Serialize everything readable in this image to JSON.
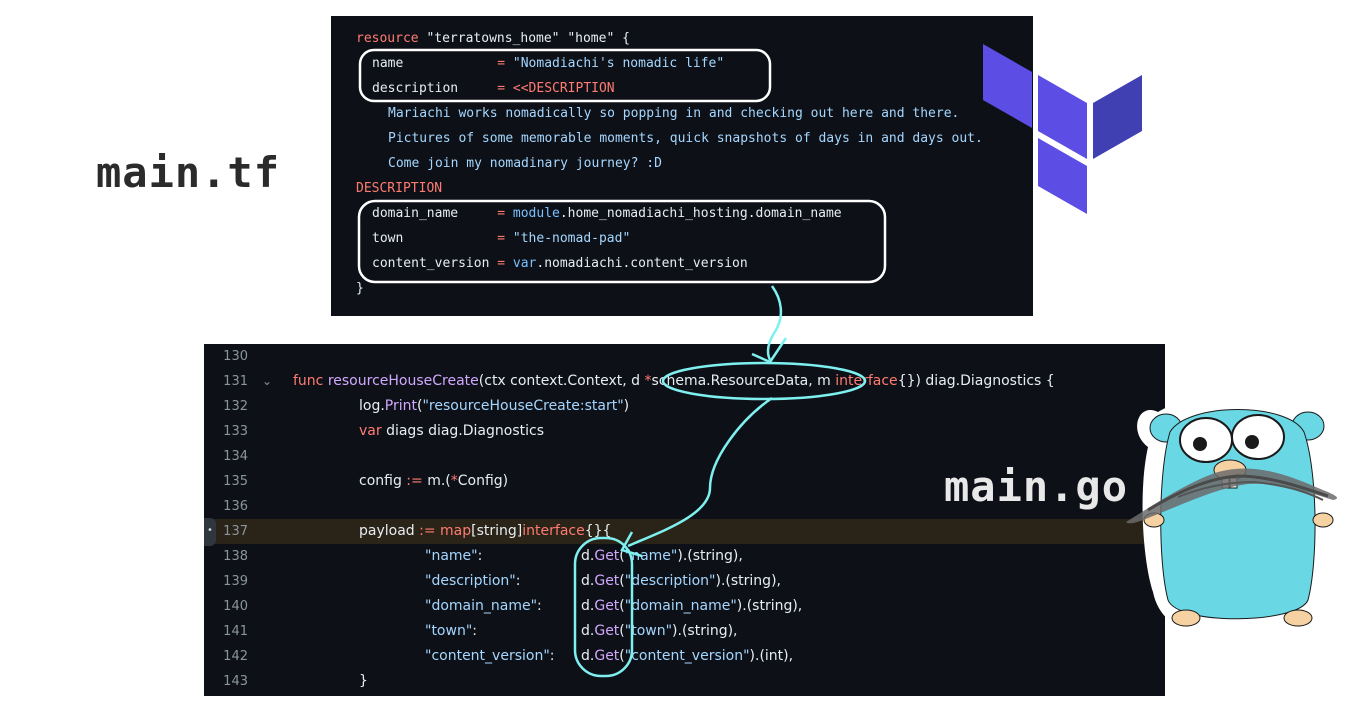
{
  "labels": {
    "terraform_file": "main.tf",
    "go_file": "main.go"
  },
  "colors": {
    "panel_bg": "#0d1117",
    "annotation_white": "#ffffff",
    "annotation_cyan": "#7ff0f0",
    "terraform_purple": "#5c4ee5",
    "terraform_dark_purple": "#4040b2",
    "gopher_blue": "#6ad7e5"
  },
  "icons": {
    "terraform_logo": "terraform-logo-icon",
    "gopher": "go-gopher-mascot-icon"
  },
  "terraform_code": {
    "l1": {
      "a": "resource",
      "b": " \"terratowns_home\" \"home\" {"
    },
    "l2": {
      "a": "name            ",
      "b": "= ",
      "c": "\"Nomadiachi's nomadic life\""
    },
    "l3": {
      "a": "description     ",
      "b": "= <<DESCRIPTION"
    },
    "l4": "Mariachi works nomadically so popping in and checking out here and there.",
    "l5": "Pictures of some memorable moments, quick snapshots of days in and days out.",
    "l6": "Come join my nomadinary journey? :D",
    "l7": "DESCRIPTION",
    "l8": {
      "a": "domain_name     ",
      "b": "= ",
      "c": "module",
      "d": ".home_nomadiachi_hosting.domain_name"
    },
    "l9": {
      "a": "town            ",
      "b": "= ",
      "c": "\"the-nomad-pad\""
    },
    "l10": {
      "a": "content_version ",
      "b": "= ",
      "c": "var",
      "d": ".nomadiachi.content_version"
    },
    "l11": "}"
  },
  "go_code": {
    "line_numbers": [
      "130",
      "131",
      "132",
      "133",
      "134",
      "135",
      "136",
      "137",
      "138",
      "139",
      "140",
      "141",
      "142",
      "143"
    ],
    "fold_arrow": "⌄",
    "gutter_dot": "•",
    "l131": {
      "a": "func ",
      "b": "resourceHouseCreate",
      "c": "(ctx context.Context, d ",
      "d": "*",
      "e": "schema.ResourceData, m ",
      "f": "interface",
      "g": "{}) diag.Diagnostics {"
    },
    "l132": {
      "a": "log.",
      "b": "Print",
      "c": "(",
      "d": "\"resourceHouseCreate:start\"",
      "e": ")"
    },
    "l133": {
      "a": "var ",
      "b": "diags diag.Diagnostics"
    },
    "l135": {
      "a": "config ",
      "b": ":= ",
      "c": "m.(",
      "d": "*",
      "e": "Config)"
    },
    "l137": {
      "a": "payload ",
      "b": ":= ",
      "c": "map",
      "d": "[string]",
      "e": "interface",
      "f": "{}{"
    },
    "l138": {
      "k": "\"name\"",
      "p": ":            ",
      "d": "d.",
      "g": "Get",
      "o": "(",
      "s": "\"name\"",
      "t": ").(string),"
    },
    "l139": {
      "k": "\"description\"",
      "p": ":     ",
      "d": "d.",
      "g": "Get",
      "o": "(",
      "s": "\"description\"",
      "t": ").(string),"
    },
    "l140": {
      "k": "\"domain_name\"",
      "p": ":     ",
      "d": "d.",
      "g": "Get",
      "o": "(",
      "s": "\"domain_name\"",
      "t": ").(string),"
    },
    "l141": {
      "k": "\"town\"",
      "p": ":            ",
      "d": "d.",
      "g": "Get",
      "o": "(",
      "s": "\"town\"",
      "t": ").(string),"
    },
    "l142": {
      "k": "\"content_version\"",
      "p": ": ",
      "d": "d.",
      "g": "Get",
      "o": "(",
      "s": "\"content_version\"",
      "t": ").(int),"
    },
    "l143": "}"
  }
}
